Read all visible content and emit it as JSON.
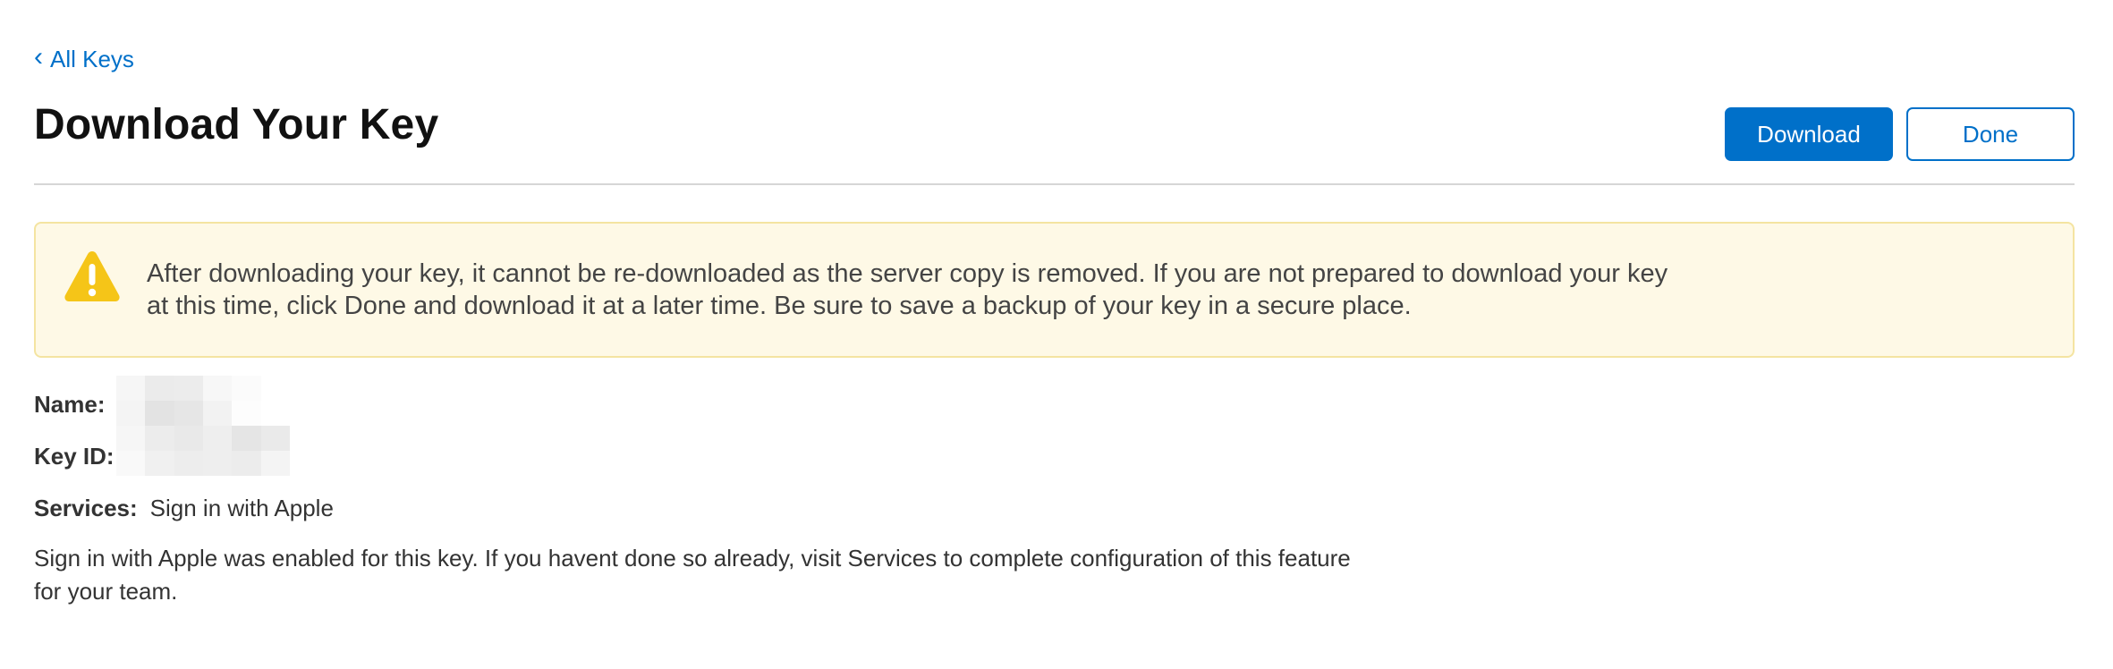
{
  "nav": {
    "back_label": "All Keys"
  },
  "header": {
    "title": "Download Your Key",
    "download_label": "Download",
    "done_label": "Done"
  },
  "alert": {
    "text": "After downloading your key, it cannot be re-downloaded as the server copy is removed. If you are not prepared to download your key at this time, click Done and download it at a later time. Be sure to save a backup of your key in a secure place.",
    "icon": "warning-triangle-icon",
    "icon_color": "#f5c518"
  },
  "details": {
    "name_label": "Name:",
    "name_value": "",
    "key_id_label": "Key ID:",
    "key_id_value": "",
    "services_label": "Services:",
    "services_value": "Sign in with Apple"
  },
  "note": "Sign in with Apple was enabled for this key. If you havent done so already, visit Services to complete configuration of this feature for your team.",
  "colors": {
    "accent": "#0070c9",
    "alert_background": "#fef9e6",
    "alert_border": "#f4e4a1",
    "divider": "#d6d6d6"
  }
}
